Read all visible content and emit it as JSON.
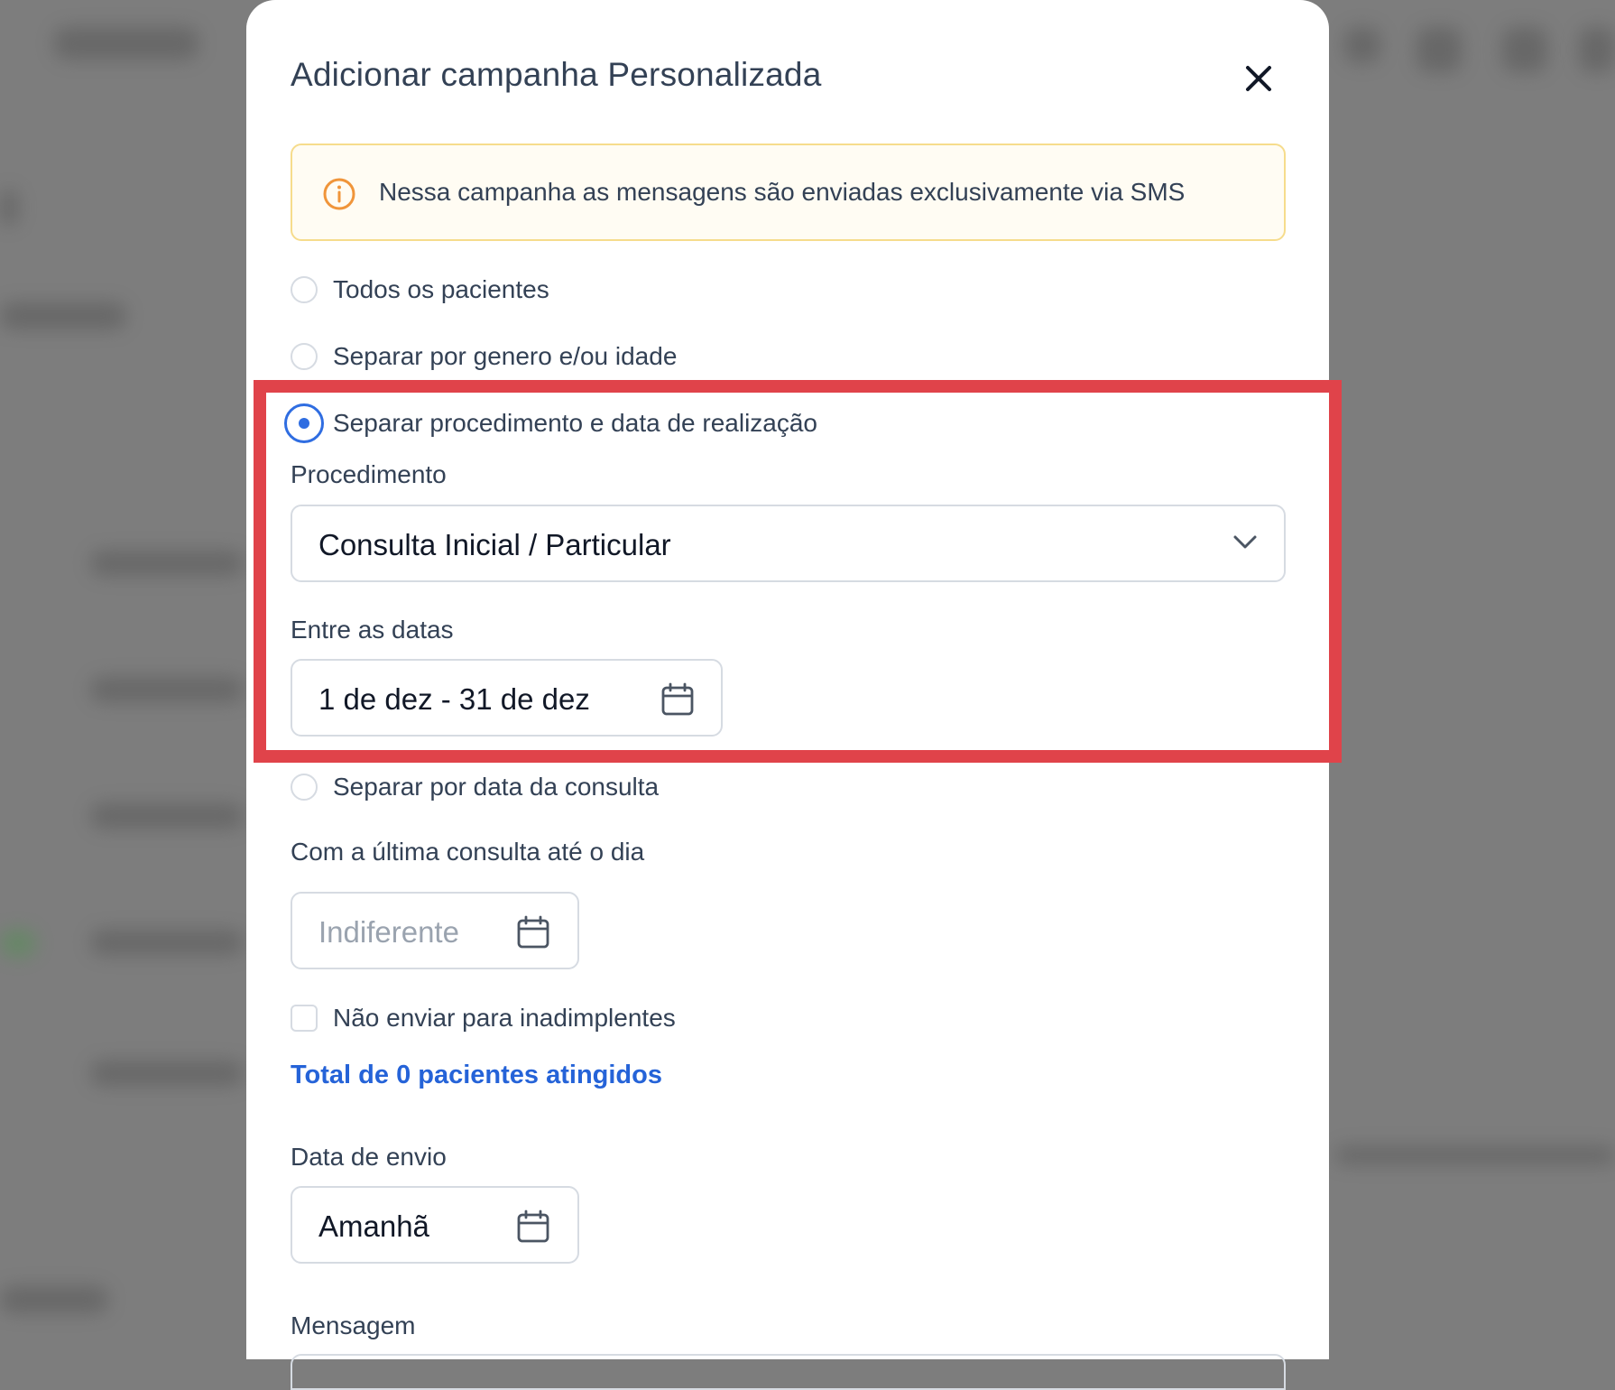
{
  "modal": {
    "title": "Adicionar campanha Personalizada",
    "close_icon": "close-icon"
  },
  "alert": {
    "icon": "info-icon",
    "text": "Nessa campanha as mensagens são enviadas exclusivamente via SMS",
    "icon_color": "#f0953a",
    "background": "#fffcf3",
    "border": "#f6dc8c"
  },
  "audience_options": [
    {
      "label": "Todos os pacientes",
      "selected": false
    },
    {
      "label": "Separar por genero e/ou idade",
      "selected": false
    },
    {
      "label": "Separar procedimento e data de realização",
      "selected": true
    },
    {
      "label": "Separar por data da consulta",
      "selected": false
    }
  ],
  "procedure": {
    "label": "Procedimento",
    "value": "Consulta Inicial / Particular"
  },
  "date_range": {
    "label": "Entre as datas",
    "value": "1 de dez - 31 de dez"
  },
  "last_consult": {
    "label": "Com a última consulta até o dia",
    "placeholder": "Indiferente"
  },
  "no_defaulters": {
    "label": "Não enviar para inadimplentes",
    "checked": false
  },
  "total_text": "Total de 0 pacientes atingidos",
  "send_date": {
    "label": "Data de envio",
    "value": "Amanhã"
  },
  "message": {
    "label": "Mensagem"
  },
  "colors": {
    "accent": "#2f6de1",
    "link": "#2563d8",
    "highlight": "#e0434a"
  }
}
